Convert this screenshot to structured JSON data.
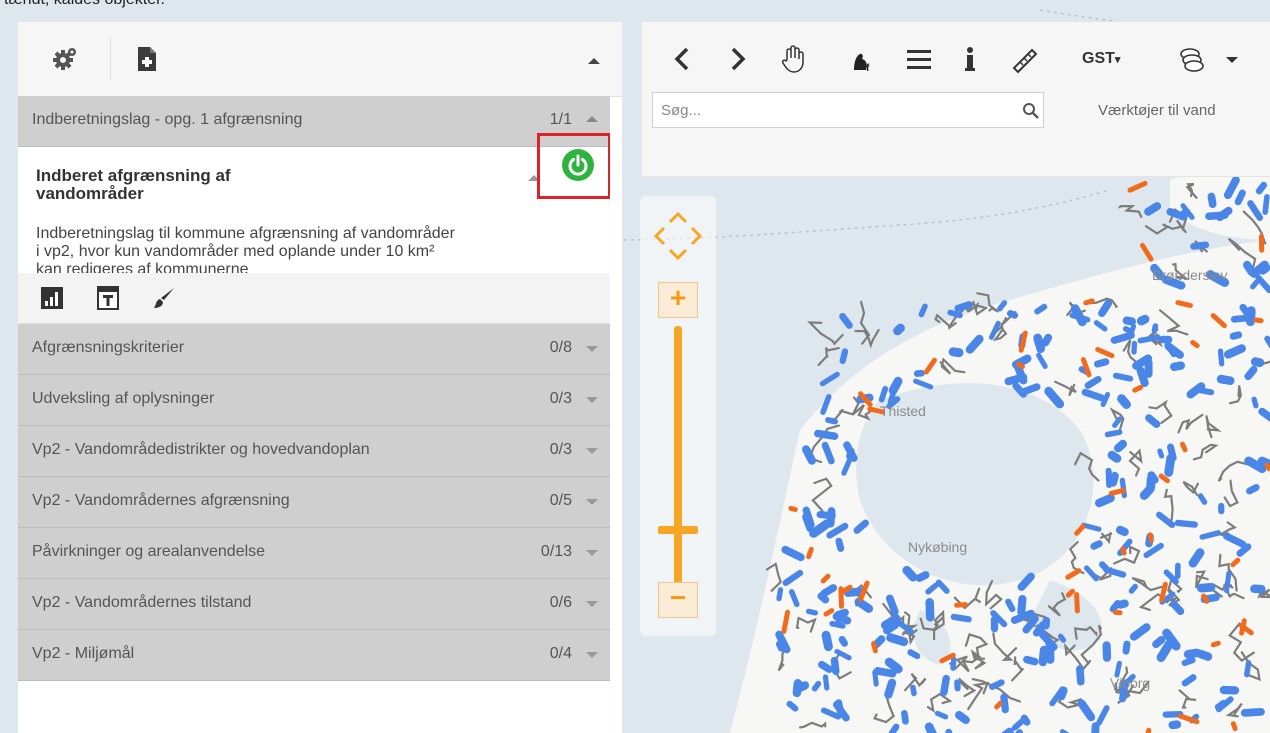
{
  "caption": "tændt, kaldes objekter.",
  "panel": {
    "header_row": {
      "label": "Indberetningslag - opg. 1 afgrænsning",
      "count": "1/1"
    },
    "expanded": {
      "title": "Indberet afgrænsning af vandområder",
      "description": "Indberetningslag til kommune afgrænsning af vandområder i vp2, hvor kun vandområder med oplande under 10 km² kan redigeres af kommunerne"
    },
    "rows": [
      {
        "label": "Afgrænsningskriterier",
        "count": "0/8"
      },
      {
        "label": "Udveksling af oplysninger",
        "count": "0/3"
      },
      {
        "label": "Vp2 - Vandområdedistrikter og hovedvandoplan",
        "count": "0/3"
      },
      {
        "label": "Vp2 - Vandområdernes afgrænsning",
        "count": "0/5"
      },
      {
        "label": "Påvirkninger og arealanvendelse",
        "count": "0/13"
      },
      {
        "label": "Vp2 - Vandområdernes tilstand",
        "count": "0/6"
      },
      {
        "label": "Vp2 - Miljømål",
        "count": "0/4"
      }
    ]
  },
  "toolbar": {
    "gst_label": "GST",
    "search_placeholder": "Søg...",
    "tools_label": "Værktøjer til vand"
  },
  "map": {
    "labels": [
      "Brønderslev",
      "Thisted",
      "Nykøbing",
      "Viborg"
    ]
  },
  "colors": {
    "accent": "#f5a623",
    "power": "#2eb33e",
    "highlight": "#d9222a",
    "water": "#4a86e8",
    "pressure": "#f26b1d"
  }
}
